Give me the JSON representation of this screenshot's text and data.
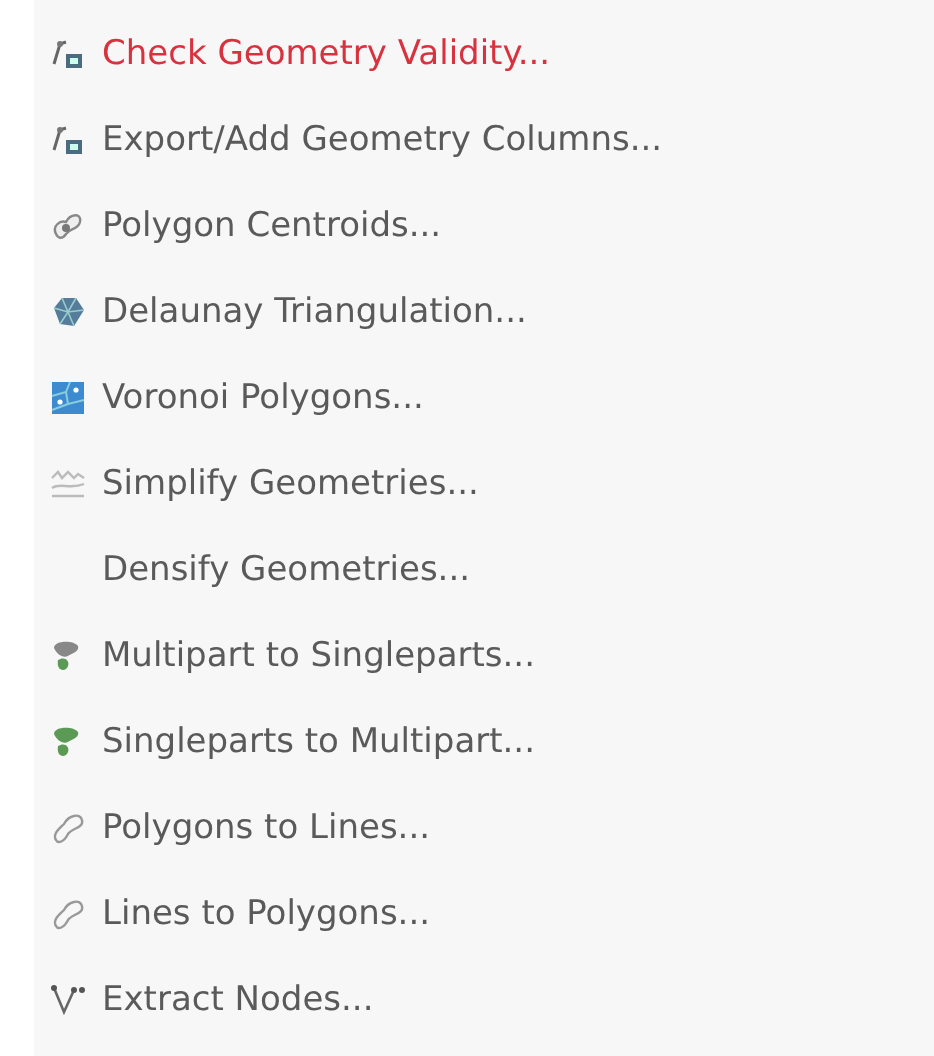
{
  "menu": {
    "items": [
      {
        "label": "Check Geometry Validity...",
        "kind": "check",
        "selected": true
      },
      {
        "label": "Export/Add Geometry Columns...",
        "kind": "export",
        "selected": false
      },
      {
        "label": "Polygon Centroids...",
        "kind": "centroid",
        "selected": false
      },
      {
        "label": "Delaunay Triangulation...",
        "kind": "delaunay",
        "selected": false
      },
      {
        "label": "Voronoi Polygons...",
        "kind": "voronoi",
        "selected": false
      },
      {
        "label": "Simplify Geometries...",
        "kind": "simplify",
        "selected": false
      },
      {
        "label": "Densify Geometries...",
        "kind": "plain",
        "selected": false
      },
      {
        "label": "Multipart to Singleparts...",
        "kind": "multipart",
        "selected": false
      },
      {
        "label": "Singleparts to Multipart...",
        "kind": "singlepart",
        "selected": false
      },
      {
        "label": "Polygons to Lines...",
        "kind": "outline",
        "selected": false
      },
      {
        "label": "Lines to Polygons...",
        "kind": "outline",
        "selected": false
      },
      {
        "label": "Extract Nodes...",
        "kind": "nodes",
        "selected": false
      }
    ]
  }
}
